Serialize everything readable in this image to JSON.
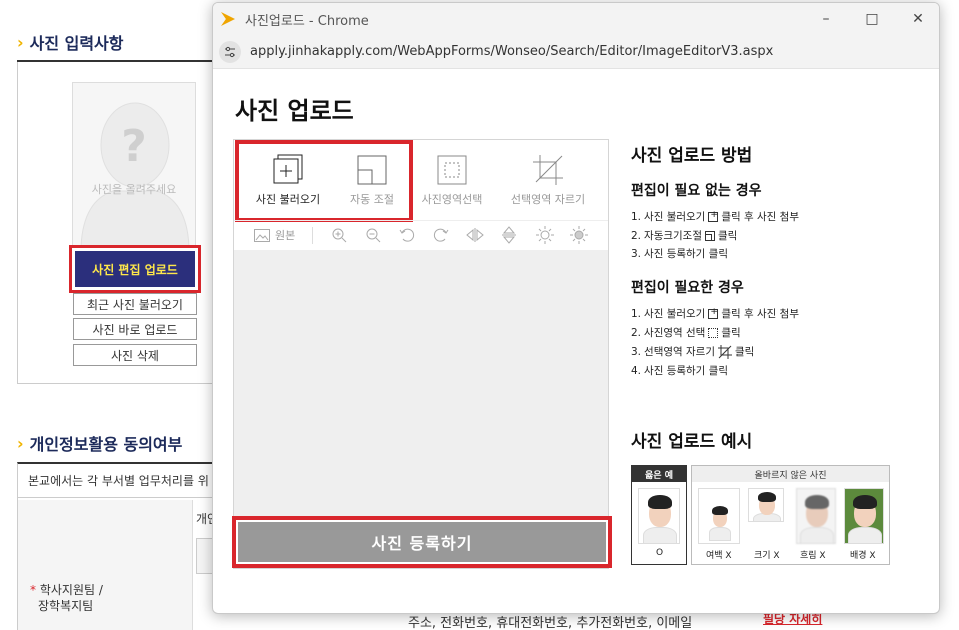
{
  "background": {
    "section_photo_title": "사진 입력사항",
    "photo_hint": "사진을 올려주세요",
    "photo_question_mark": "?",
    "edit_upload_button": "사진 편집 업로드",
    "recent_photo_button": "최근 사진 불러오기",
    "direct_upload_button": "사진 바로 업로드",
    "delete_photo_button": "사진 삭제",
    "section_consent_title": "개인정보활용 동의여부",
    "consent_row_text": "본교에서는 각 부서별 업무처리를 위",
    "required_mark": "*",
    "required_label_line1": "학사지원팀 /",
    "required_label_line2": "장학복지팀",
    "sub_text": "개인",
    "bottom_text": "주소, 전화번호, 휴대전화번호, 추가전화번호, 이메일",
    "bottom_link": "필당 자세히"
  },
  "popup": {
    "window_title": "사진업로드 - Chrome",
    "url": "apply.jinhakapply.com/WebAppForms/Wonseo/Search/Editor/ImageEditorV3.aspx",
    "page_title": "사진 업로드",
    "tools": [
      {
        "label": "사진 불러오기",
        "icon": "add-photo-icon"
      },
      {
        "label": "자동 조절",
        "icon": "auto-fit-icon"
      },
      {
        "label": "사진영역선택",
        "icon": "select-area-icon"
      },
      {
        "label": "선택영역 자르기",
        "icon": "crop-icon"
      }
    ],
    "original_label": "원본",
    "register_button": "사진 등록하기",
    "howto": {
      "title": "사진 업로드 방법",
      "no_edit_title": "편집이 필요 없는 경우",
      "no_edit_steps": [
        {
          "num": "1.",
          "pre": "사진 불러오기",
          "post": "클릭 후 사진 첨부"
        },
        {
          "num": "2.",
          "pre": "자동크기조절",
          "post": "클릭"
        },
        {
          "num": "3.",
          "pre": "사진 등록하기 클릭",
          "post": ""
        }
      ],
      "edit_title": "편집이 필요한 경우",
      "edit_steps": [
        {
          "num": "1.",
          "pre": "사진 불러오기",
          "post": "클릭 후 사진 첨부"
        },
        {
          "num": "2.",
          "pre": "사진영역 선택",
          "post": "클릭"
        },
        {
          "num": "3.",
          "pre": "선택영역 자르기",
          "post": "클릭"
        },
        {
          "num": "4.",
          "pre": "사진 등록하기 클릭",
          "post": ""
        }
      ]
    },
    "example": {
      "title": "사진 업로드 예시",
      "good_header": "옳은 예",
      "good_caption": "O",
      "bad_header": "올바르지 않은 사진",
      "bad_captions": [
        "여백 X",
        "크기 X",
        "흐림 X",
        "배경 X"
      ]
    }
  },
  "colors": {
    "highlight_red": "#d9262c",
    "navy_button": "#2b2f7c",
    "button_text_yellow": "#ffe84a",
    "register_gray": "#999999",
    "chevron_yellow": "#f0b400"
  }
}
